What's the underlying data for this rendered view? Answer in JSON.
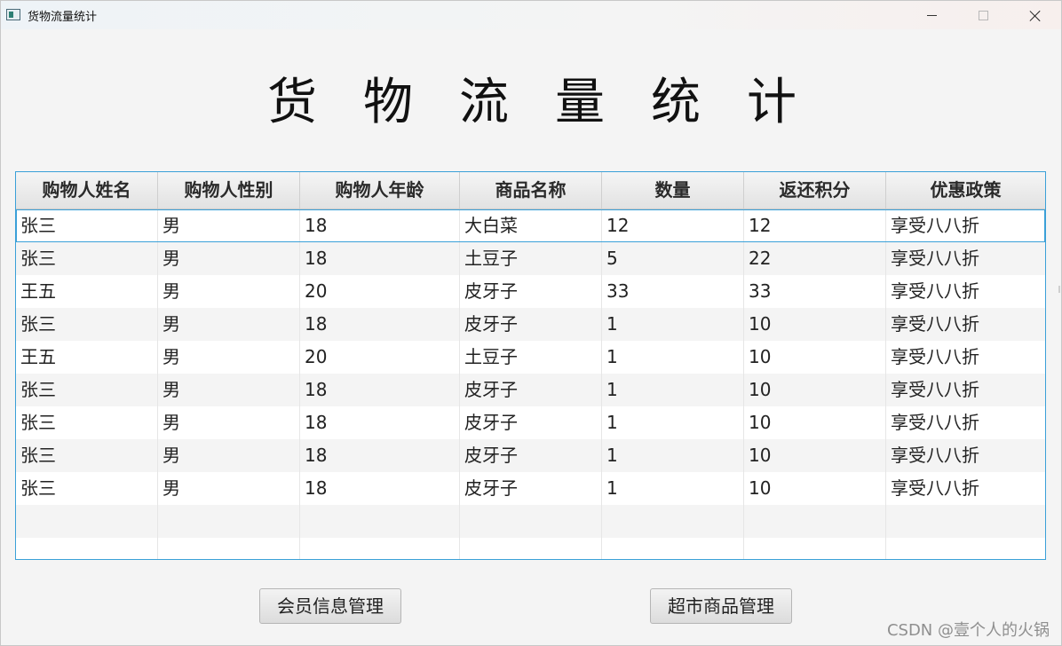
{
  "window": {
    "title": "货物流量统计"
  },
  "page": {
    "heading": "货物流量统计"
  },
  "table": {
    "columns": [
      "购物人姓名",
      "购物人性别",
      "购物人年龄",
      "商品名称",
      "数量",
      "返还积分",
      "优惠政策"
    ],
    "rows": [
      [
        "张三",
        "男",
        "18",
        "大白菜",
        "12",
        "12",
        "享受八八折"
      ],
      [
        "张三",
        "男",
        "18",
        "土豆子",
        "5",
        "22",
        "享受八八折"
      ],
      [
        "王五",
        "男",
        "20",
        "皮牙子",
        "33",
        "33",
        "享受八八折"
      ],
      [
        "张三",
        "男",
        "18",
        "皮牙子",
        "1",
        "10",
        "享受八八折"
      ],
      [
        "王五",
        "男",
        "20",
        "土豆子",
        "1",
        "10",
        "享受八八折"
      ],
      [
        "张三",
        "男",
        "18",
        "皮牙子",
        "1",
        "10",
        "享受八八折"
      ],
      [
        "张三",
        "男",
        "18",
        "皮牙子",
        "1",
        "10",
        "享受八八折"
      ],
      [
        "张三",
        "男",
        "18",
        "皮牙子",
        "1",
        "10",
        "享受八八折"
      ],
      [
        "张三",
        "男",
        "18",
        "皮牙子",
        "1",
        "10",
        "享受八八折"
      ]
    ],
    "selected_row": 0
  },
  "buttons": {
    "member_label": "会员信息管理",
    "goods_label": "超市商品管理"
  },
  "watermark": {
    "text": "CSDN @壹个人的火锅"
  },
  "icons": {
    "app": "app-window-icon",
    "minimize": "minimize-icon",
    "maximize": "maximize-icon",
    "close": "close-icon"
  },
  "colors": {
    "table_border": "#3aa0d8",
    "selection_outline": "#3aa0d8"
  }
}
